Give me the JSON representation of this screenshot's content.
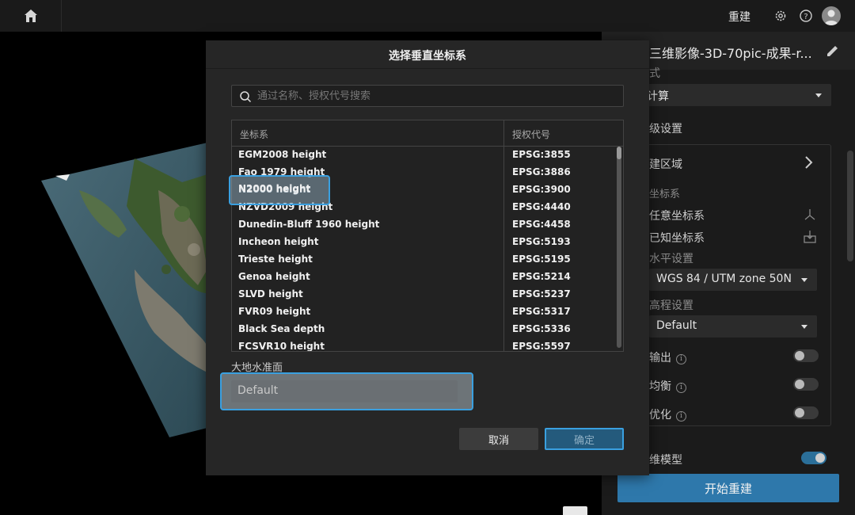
{
  "topbar": {
    "rebuild_label": "重建",
    "icons": [
      "home-icon",
      "gear-icon",
      "help-icon",
      "user-icon"
    ]
  },
  "panel": {
    "title": "三维影像-3D-70pic-成果-r...",
    "mode_label": "式",
    "mode_value": "计算",
    "advanced_label": "级设置",
    "region_label": "建区域",
    "coord_label": "坐标系",
    "coord_any": "任意坐标系",
    "coord_known": "已知坐标系",
    "horizontal_label": "水平设置",
    "horizontal_value": "WGS 84 / UTM zone 50N",
    "elevation_label": "高程设置",
    "elevation_value": "Default",
    "option1": "输出",
    "option2": "均衡",
    "option3": "优化",
    "model_label": "维模型",
    "start_button": "开始重建"
  },
  "modal": {
    "title": "选择垂直坐标系",
    "search_placeholder": "通过名称、授权代号搜索",
    "col_name": "坐标系",
    "col_code": "授权代号",
    "rows": [
      {
        "name": "EGM2008 height",
        "code": "EPSG:3855"
      },
      {
        "name": "Fao 1979 height",
        "code": "EPSG:3886"
      },
      {
        "name": "N2000 height",
        "code": "EPSG:3900"
      },
      {
        "name": "NZVD2009 height",
        "code": "EPSG:4440"
      },
      {
        "name": "Dunedin-Bluff 1960 height",
        "code": "EPSG:4458"
      },
      {
        "name": "Incheon height",
        "code": "EPSG:5193"
      },
      {
        "name": "Trieste height",
        "code": "EPSG:5195"
      },
      {
        "name": "Genoa height",
        "code": "EPSG:5214"
      },
      {
        "name": "SLVD height",
        "code": "EPSG:5237"
      },
      {
        "name": "FVR09 height",
        "code": "EPSG:5317"
      },
      {
        "name": "Black Sea depth",
        "code": "EPSG:5336"
      },
      {
        "name": "FCSVR10 height",
        "code": "EPSG:5597"
      }
    ],
    "highlighted_row": "N2000 height",
    "geoid_label": "大地水准面",
    "geoid_value": "Default",
    "cancel_label": "取消",
    "ok_label": "确定"
  },
  "colors": {
    "accent": "#3aa0e0",
    "primary_button": "#2e78ab"
  }
}
